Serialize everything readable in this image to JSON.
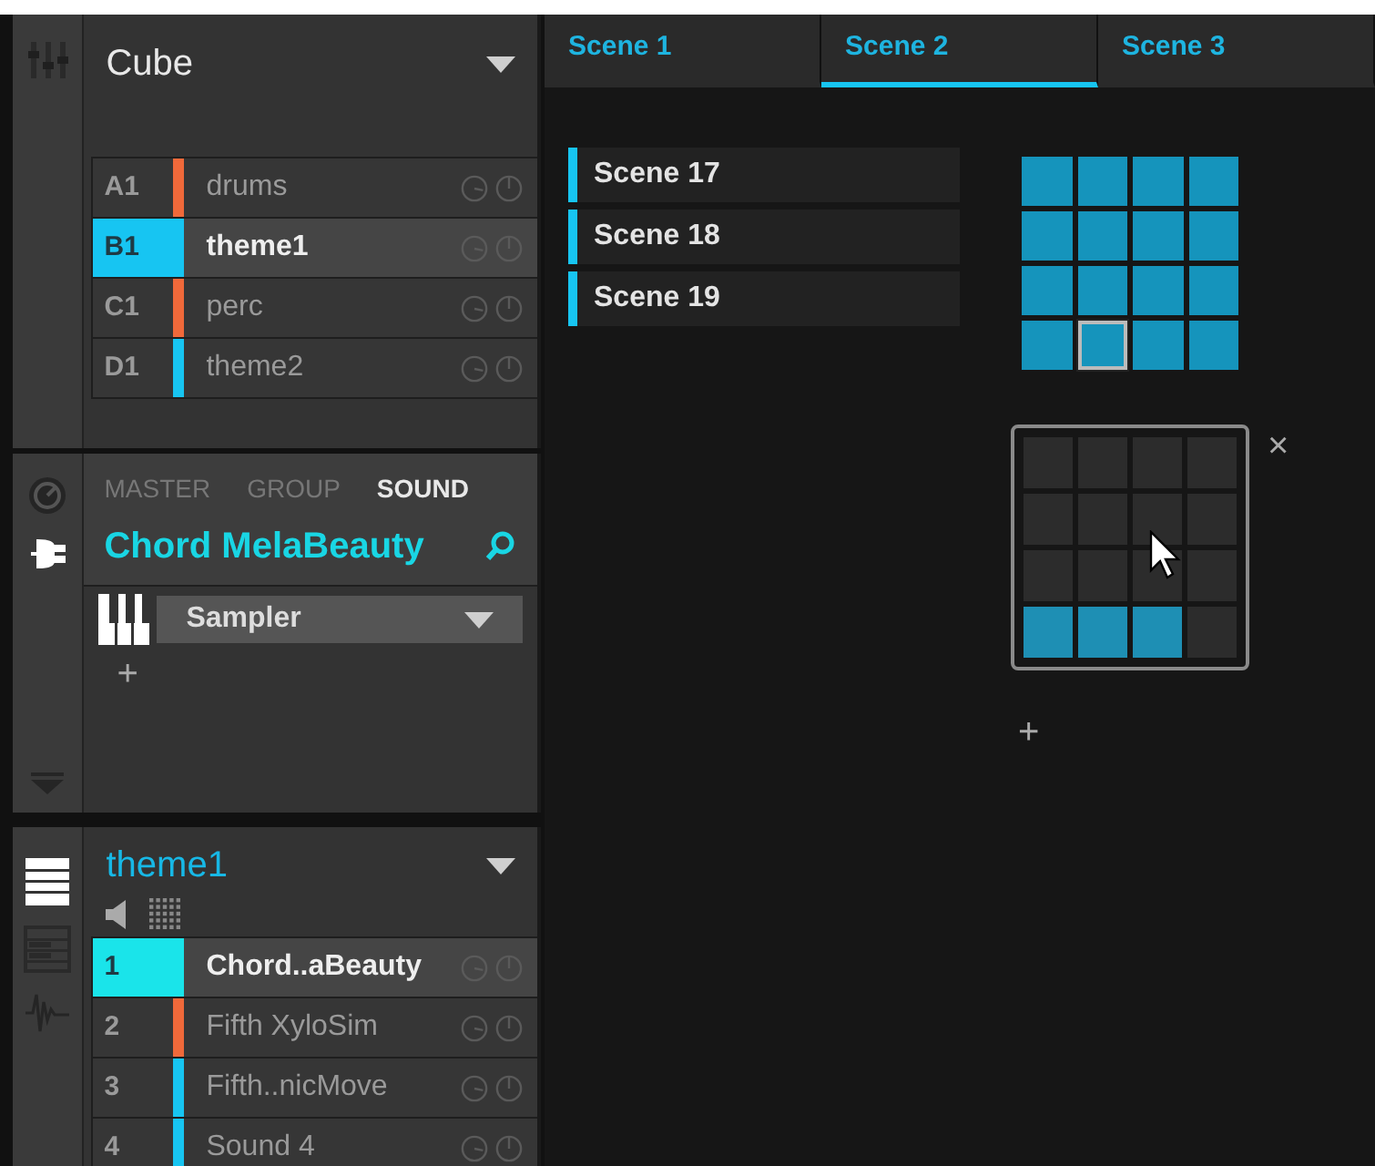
{
  "nav_top": [
    {
      "kind": "mixer",
      "selected": false
    }
  ],
  "nav_middle": [
    {
      "kind": "knob",
      "selected": false
    },
    {
      "kind": "plug",
      "selected": true
    }
  ],
  "nav_bottom": [
    {
      "kind": "rows",
      "selected": true
    },
    {
      "kind": "keys",
      "selected": false
    },
    {
      "kind": "wave",
      "selected": false
    }
  ],
  "project": {
    "title": "Cube"
  },
  "groups": [
    {
      "slot": "A1",
      "name": "drums",
      "color": "#f0693a",
      "selected": false
    },
    {
      "slot": "B1",
      "name": "theme1",
      "color": "#17c5f2",
      "selected": true
    },
    {
      "slot": "C1",
      "name": "perc",
      "color": "#f0693a",
      "selected": false
    },
    {
      "slot": "D1",
      "name": "theme2",
      "color": "#17c5f2",
      "selected": false
    }
  ],
  "sound_panel": {
    "tabs": [
      {
        "label": "MASTER",
        "selected": false
      },
      {
        "label": "GROUP",
        "selected": false
      },
      {
        "label": "SOUND",
        "selected": true
      }
    ],
    "name": "Chord MelaBeauty",
    "plugins": [
      {
        "name": "Sampler"
      }
    ],
    "add": "+"
  },
  "group_panel": {
    "title": "theme1",
    "sounds": [
      {
        "number": "1",
        "name": "Chord..aBeauty",
        "color": "#1ae4ea",
        "selected": true
      },
      {
        "number": "2",
        "name": "Fifth XyloSim",
        "color": "#f0693a",
        "selected": false
      },
      {
        "number": "3",
        "name": "Fifth..nicMove",
        "color": "#17c5f2",
        "selected": false
      },
      {
        "number": "4",
        "name": "Sound 4",
        "color": "#17c5f2",
        "selected": false
      }
    ]
  },
  "scene_tabs": [
    {
      "label": "Scene 1",
      "selected": false
    },
    {
      "label": "Scene 2",
      "selected": true
    },
    {
      "label": "Scene 3",
      "selected": false
    }
  ],
  "scene_list": [
    {
      "name": "Scene 17"
    },
    {
      "name": "Scene 18"
    },
    {
      "name": "Scene 19"
    }
  ],
  "pad_bank": [
    {
      "selected": false
    },
    {
      "selected": false
    },
    {
      "selected": false
    },
    {
      "selected": false
    },
    {
      "selected": false
    },
    {
      "selected": false
    },
    {
      "selected": false
    },
    {
      "selected": false
    },
    {
      "selected": false
    },
    {
      "selected": false
    },
    {
      "selected": false
    },
    {
      "selected": false
    },
    {
      "selected": false
    },
    {
      "selected": true
    },
    {
      "selected": false
    },
    {
      "selected": false
    }
  ],
  "pad_editor": {
    "cells": [
      {
        "on": false
      },
      {
        "on": false
      },
      {
        "on": false
      },
      {
        "on": false
      },
      {
        "on": false
      },
      {
        "on": false
      },
      {
        "on": false
      },
      {
        "on": false
      },
      {
        "on": false
      },
      {
        "on": false
      },
      {
        "on": false
      },
      {
        "on": false
      },
      {
        "on": true
      },
      {
        "on": true
      },
      {
        "on": true
      },
      {
        "on": false
      }
    ],
    "close": "×",
    "add": "+"
  }
}
